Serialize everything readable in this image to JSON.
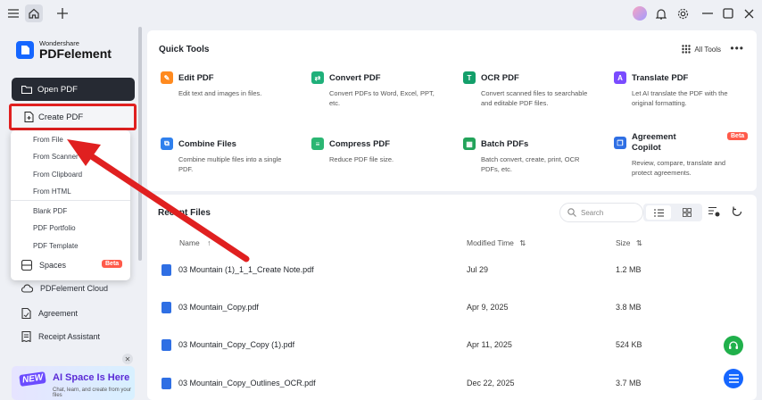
{
  "titlebar": {
    "icons": [
      "menu-icon",
      "home-icon",
      "plus-icon",
      "avatar",
      "bell-icon",
      "gear-icon",
      "minimize-icon",
      "maximize-icon",
      "close-icon"
    ]
  },
  "logo": {
    "small": "Wondershare",
    "big": "PDFelement"
  },
  "sidebar": {
    "open_pdf": "Open PDF",
    "create_pdf": "Create PDF",
    "create_menu": [
      "From File",
      "From Scanner",
      "From Clipboard",
      "From HTML",
      "Blank PDF",
      "PDF Portfolio",
      "PDF Template"
    ],
    "items": [
      {
        "label": "Spaces",
        "badge": "Beta"
      },
      {
        "label": "PDFelement Cloud"
      },
      {
        "label": "Agreement"
      },
      {
        "label": "Receipt Assistant"
      }
    ],
    "banner": {
      "new": "NEW",
      "title": "AI Space Is Here",
      "sub": "Chat, learn, and create from your files"
    }
  },
  "quick_tools": {
    "title": "Quick Tools",
    "all_tools": "All Tools",
    "tools": [
      {
        "name": "Edit PDF",
        "desc": "Edit text and images in files.",
        "color": "#ff8a1f",
        "glyph": "✎"
      },
      {
        "name": "Convert PDF",
        "desc": "Convert PDFs to Word, Excel, PPT, etc.",
        "color": "#1fb07a",
        "glyph": "⇄"
      },
      {
        "name": "OCR PDF",
        "desc": "Convert scanned files to searchable and editable PDF files.",
        "color": "#139f6a",
        "glyph": "T"
      },
      {
        "name": "Translate PDF",
        "desc": "Let AI translate the PDF with the original formatting.",
        "color": "#7a4bff",
        "glyph": "A"
      },
      {
        "name": "Combine Files",
        "desc": "Combine multiple files into a single PDF.",
        "color": "#2f80ed",
        "glyph": "⧉"
      },
      {
        "name": "Compress PDF",
        "desc": "Reduce PDF file size.",
        "color": "#2bb673",
        "glyph": "≡"
      },
      {
        "name": "Batch PDFs",
        "desc": "Batch convert, create, print, OCR PDFs, etc.",
        "color": "#22a35a",
        "glyph": "▦"
      },
      {
        "name": "Agreement Copilot",
        "desc": "Review, compare, translate and protect agreements.",
        "color": "#2f6fe4",
        "glyph": "❐",
        "badge": "Beta"
      }
    ]
  },
  "recent": {
    "title": "Recent Files",
    "search_placeholder": "Search",
    "columns": {
      "name": "Name",
      "modified": "Modified Time",
      "size": "Size"
    },
    "files": [
      {
        "name": "03 Mountain (1)_1_1_Create Note.pdf",
        "modified": "Jul 29",
        "size": "1.2 MB"
      },
      {
        "name": "03 Mountain_Copy.pdf",
        "modified": "Apr 9, 2025",
        "size": "3.8 MB"
      },
      {
        "name": "03 Mountain_Copy_Copy (1).pdf",
        "modified": "Apr 11, 2025",
        "size": "524 KB"
      },
      {
        "name": "03 Mountain_Copy_Outlines_OCR.pdf",
        "modified": "Dec 22, 2025",
        "size": "3.7 MB"
      }
    ]
  },
  "colors": {
    "accent": "#1566ff",
    "highlight": "#e02020",
    "sidebar_bg": "#eef0f5"
  }
}
